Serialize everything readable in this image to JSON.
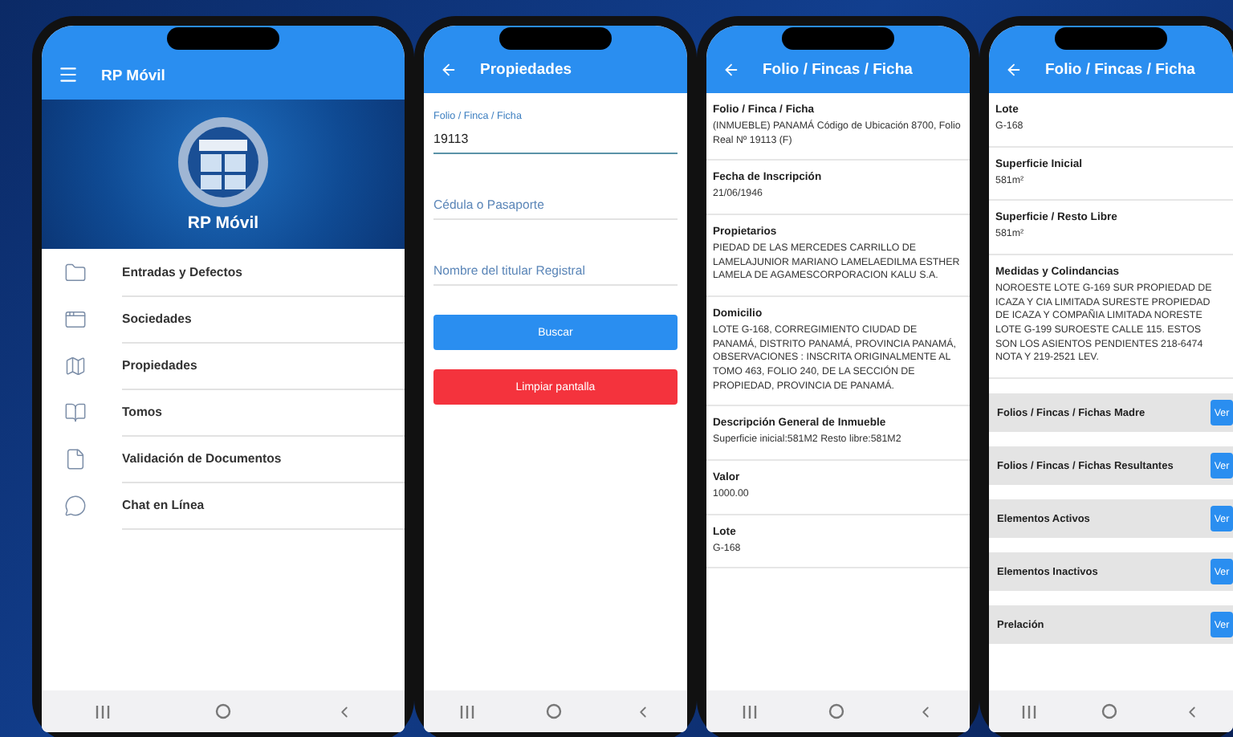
{
  "phones": [
    {
      "kind": "menu",
      "title": "RP Móvil",
      "banner_title": "RP Móvil",
      "items": [
        {
          "label": "Entradas y Defectos"
        },
        {
          "label": "Sociedades"
        },
        {
          "label": "Propiedades"
        },
        {
          "label": "Tomos"
        },
        {
          "label": "Validación de Documentos"
        },
        {
          "label": "Chat en Línea"
        }
      ]
    },
    {
      "kind": "form",
      "title": "Propiedades",
      "fields": [
        {
          "label": "Folio / Finca / Ficha",
          "value": "19113"
        },
        {
          "placeholder": "Cédula o Pasaporte"
        },
        {
          "placeholder": "Nombre del titular Registral"
        }
      ],
      "buttons": [
        {
          "label": "Buscar",
          "kind": "primary"
        },
        {
          "label": "Limpiar pantalla",
          "kind": "danger"
        }
      ]
    },
    {
      "kind": "detail",
      "title": "Folio / Fincas / Ficha",
      "sections": [
        {
          "label": "Folio / Finca / Ficha",
          "value": "(INMUEBLE) PANAMÁ Código de Ubicación 8700, Folio Real Nº 19113 (F)"
        },
        {
          "label": "Fecha de Inscripción",
          "value": "21/06/1946"
        },
        {
          "label": "Propietarios",
          "value": "PIEDAD DE LAS MERCEDES CARRILLO DE LAMELAJUNIOR MARIANO LAMELAEDILMA ESTHER LAMELA DE AGAMESCORPORACION KALU S.A."
        },
        {
          "label": "Domicilio",
          "value": "LOTE G-168, CORREGIMIENTO CIUDAD DE PANAMÁ, DISTRITO PANAMÁ, PROVINCIA PANAMÁ, OBSERVACIONES : INSCRITA ORIGINALMENTE AL TOMO 463, FOLIO 240, DE LA SECCIÓN DE PROPIEDAD, PROVINCIA DE PANAMÁ."
        },
        {
          "label": "Descripción General de Inmueble",
          "value": "Superficie inicial:581M2 Resto libre:581M2"
        },
        {
          "label": "Valor",
          "value": "1000.00"
        },
        {
          "label": "Lote",
          "value": "G-168"
        }
      ]
    },
    {
      "kind": "detail",
      "title": "Folio / Fincas / Ficha",
      "sections": [
        {
          "label": "Lote",
          "value": "G-168"
        },
        {
          "label": "Superficie Inicial",
          "value": "581m²"
        },
        {
          "label": "Superficie / Resto Libre",
          "value": "581m²"
        },
        {
          "label": "Medidas y Colindancias",
          "value": "NOROESTE LOTE G-169 SUR PROPIEDAD DE ICAZA Y CIA LIMITADA SURESTE PROPIEDAD DE ICAZA Y COMPAÑIA LIMITADA NORESTE LOTE G-199 SUROESTE CALLE 115. ESTOS SON LOS ASIENTOS PENDIENTES 218-6474 NOTA Y 219-2521 LEV."
        }
      ],
      "links": [
        {
          "label": "Folios / Fincas / Fichas Madre",
          "button": "Ver"
        },
        {
          "label": "Folios / Fincas / Fichas Resultantes",
          "button": "Ver"
        },
        {
          "label": "Elementos Activos",
          "button": "Ver"
        },
        {
          "label": "Elementos Inactivos",
          "button": "Ver"
        },
        {
          "label": "Prelación",
          "button": "Ver"
        }
      ]
    }
  ]
}
